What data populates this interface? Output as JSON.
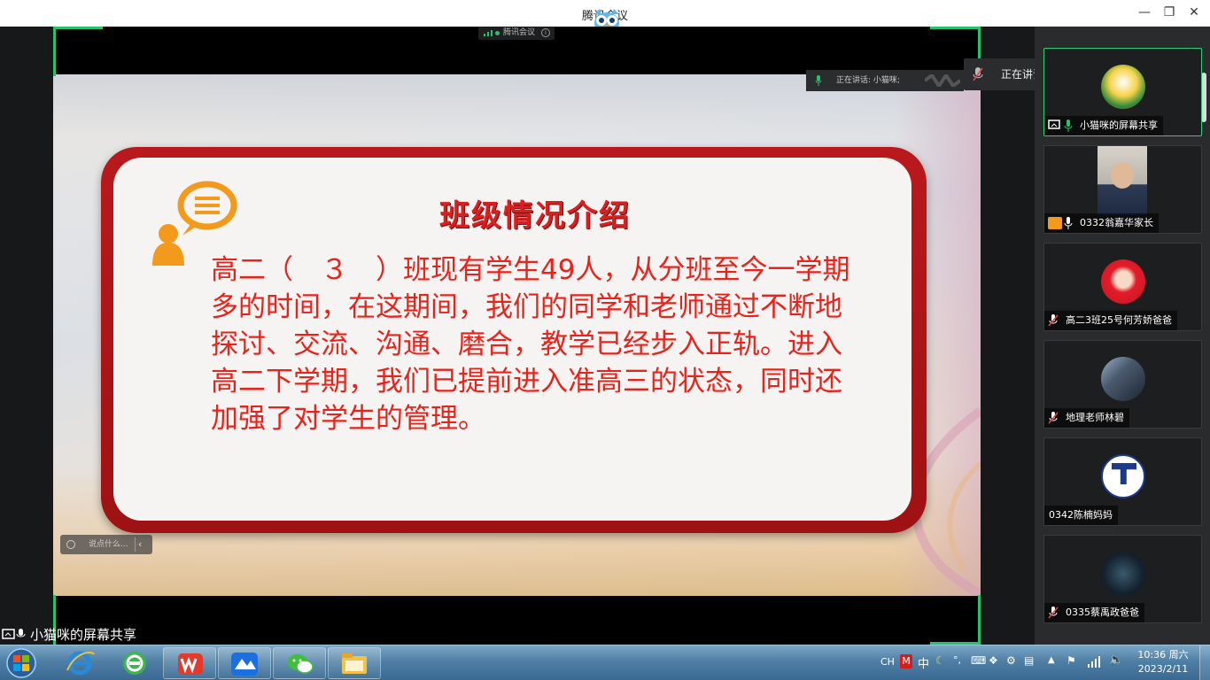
{
  "window": {
    "title": "腾讯会议",
    "minimize_glyph": "—",
    "maximize_glyph": "❐",
    "close_glyph": "✕"
  },
  "meeting_pill": {
    "label": "腾讯会议",
    "info_glyph": "i"
  },
  "speaking": {
    "small_label": "正在讲话: 小猫咪;",
    "big_label": "正在讲话: 小猫咪;"
  },
  "slide": {
    "title": "班级情况介绍",
    "body": "高二（　３　）班现有学生49人，从分班至今一学期多的时间，在这期间，我们的同学和老师通过不断地探讨、交流、沟通、磨合，教学已经步入正轨。进入高二下学期，我们已提前进入准高三的状态，同时还加强了对学生的管理。"
  },
  "chat": {
    "placeholder": "说点什么...",
    "chevron": "‹"
  },
  "share_label": "小猫咪的屏幕共享",
  "participants": [
    {
      "name": "小猫咪的屏幕共享",
      "icons": [
        "screen-share-icon",
        "mic-on-icon"
      ]
    },
    {
      "name": "0332翁嘉华家长",
      "icons": [
        "user-icon",
        "mic-on-icon"
      ]
    },
    {
      "name": "高二3班25号何芳娇爸爸",
      "icons": [
        "mic-muted-icon"
      ]
    },
    {
      "name": "地理老师林碧",
      "icons": [
        "mic-muted-icon"
      ]
    },
    {
      "name": "0342陈楠妈妈",
      "icons": []
    },
    {
      "name": "0335蔡禹政爸爸",
      "icons": [
        "mic-muted-icon"
      ]
    }
  ],
  "taskbar": {
    "apps": [
      "start-menu",
      "internet-explorer",
      "360-browser",
      "wps-office",
      "tencent-meeting",
      "wechat",
      "file-explorer"
    ],
    "tray": {
      "lang": "CH",
      "ime": "中",
      "ime_punct": "°,",
      "time": "10:36 周六",
      "date": "2023/2/11"
    }
  },
  "colors": {
    "accent_green": "#27c26b",
    "slide_red": "#e8231b",
    "card_red": "#b9191c",
    "icon_orange": "#f39a1c"
  }
}
